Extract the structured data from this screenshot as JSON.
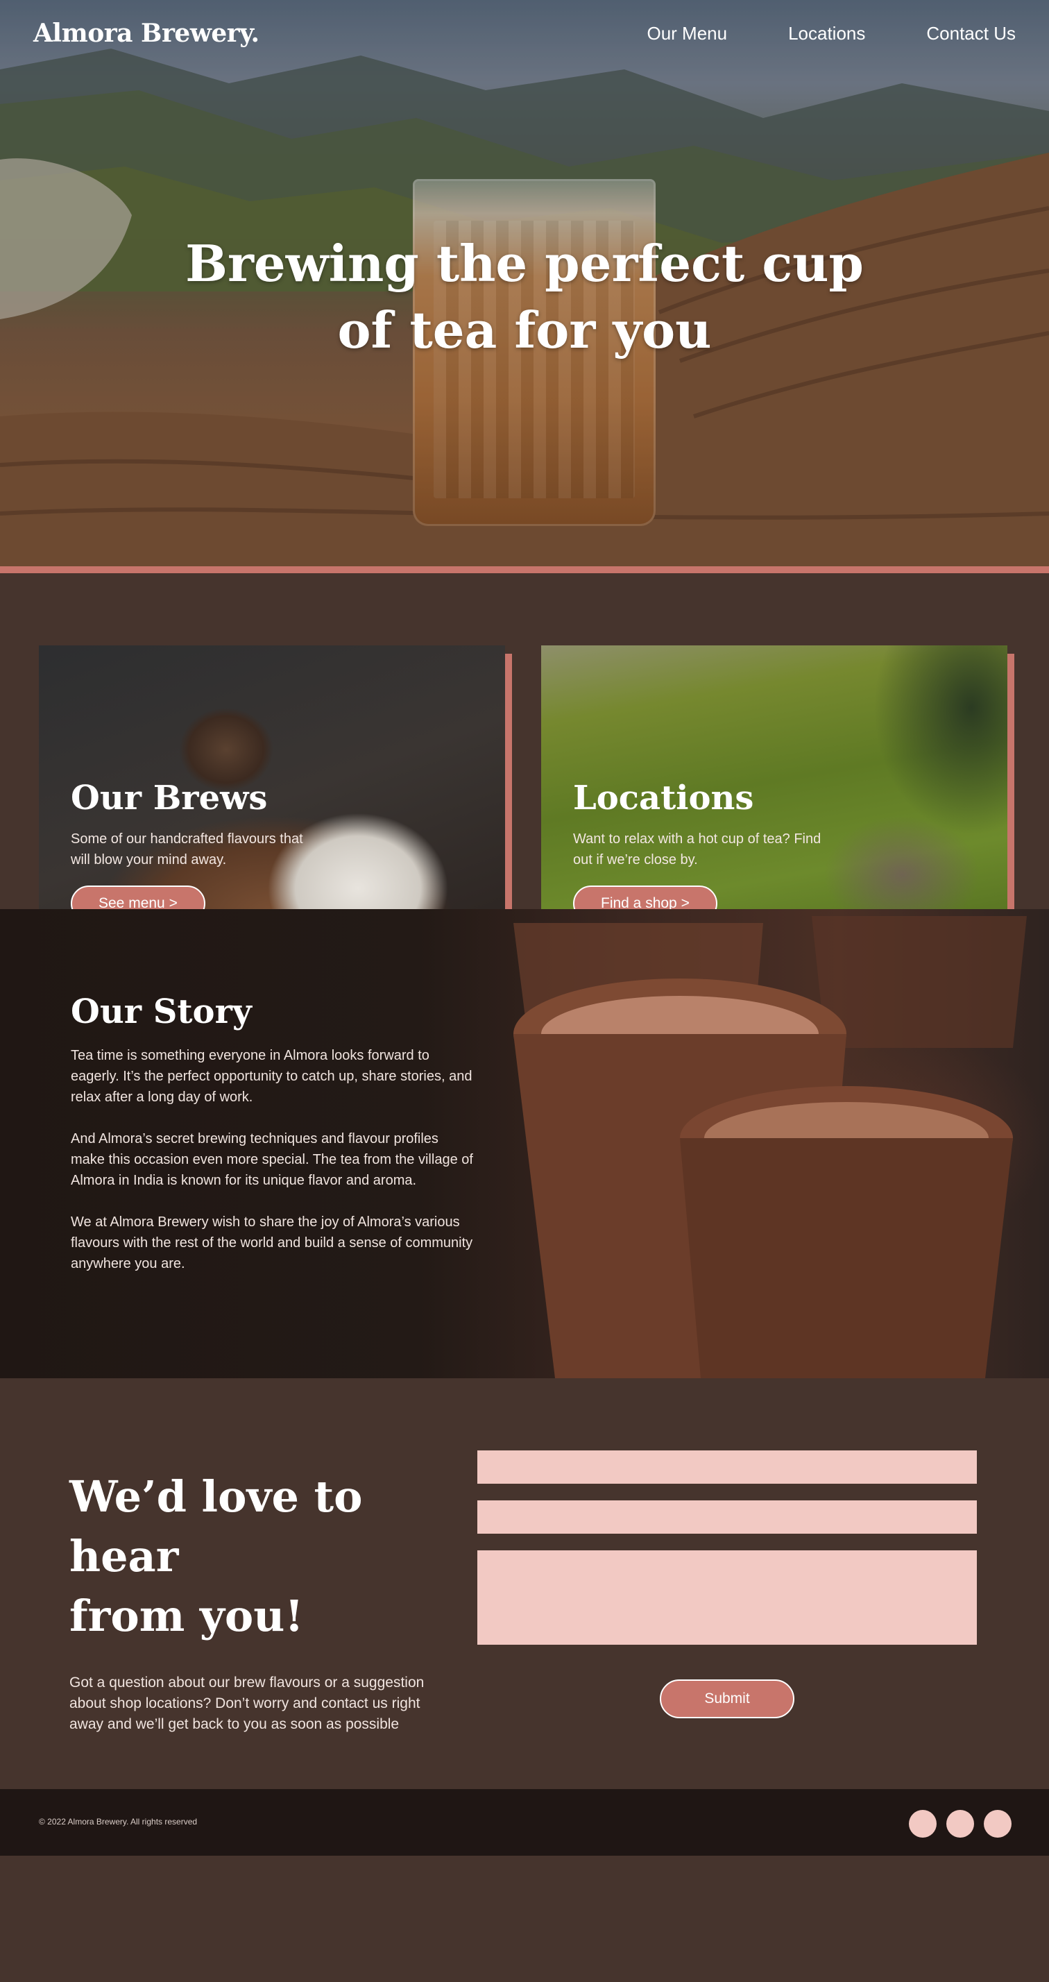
{
  "brand": "Almora Brewery.",
  "nav": {
    "items": [
      {
        "label": "Our Menu"
      },
      {
        "label": "Locations"
      },
      {
        "label": "Contact Us"
      }
    ]
  },
  "hero": {
    "title_line1": "Brewing the perfect cup",
    "title_line2": "of tea for you"
  },
  "cards": [
    {
      "title": "Our Brews",
      "text": "Some of our handcrafted flavours that will blow your mind away.",
      "button": "See menu >"
    },
    {
      "title": "Locations",
      "text": "Want to relax with a hot cup of tea? Find out if we’re close by.",
      "button": "Find a shop >"
    }
  ],
  "story": {
    "title": "Our Story",
    "paragraphs": [
      "Tea time is something everyone in Almora looks forward to eagerly. It’s the perfect opportunity to catch up, share stories, and relax after a long day of work.",
      "And Almora’s secret brewing techniques and flavour profiles make this occasion even more special. The tea from the village of Almora in India is known for its unique flavor and aroma.",
      "We at Almora Brewery wish to share the joy of Almora’s various flavours with the rest of the world and build a sense of community anywhere you are."
    ]
  },
  "contact": {
    "title_line1": "We’d love to hear",
    "title_line2": "from you!",
    "text": "Got a question about our brew flavours or a suggestion about shop locations? Don’t worry and contact us right away and we’ll get back to you as soon as possible",
    "submit": "Submit"
  },
  "footer": {
    "copyright": "© 2022 Almora Brewery. All rights reserved"
  },
  "colors": {
    "accent": "#c8756b",
    "background": "#46342d",
    "field": "#f2c9c3",
    "footer": "#1f1614",
    "story_bg": "#201714"
  },
  "icons": {
    "socials": [
      "social-icon-1",
      "social-icon-2",
      "social-icon-3"
    ]
  }
}
